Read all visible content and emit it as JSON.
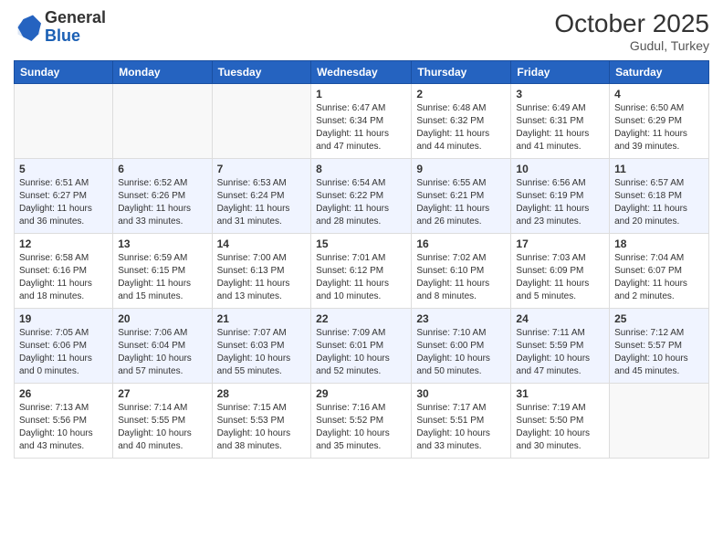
{
  "header": {
    "logo_general": "General",
    "logo_blue": "Blue",
    "month_title": "October 2025",
    "location": "Gudul, Turkey"
  },
  "weekdays": [
    "Sunday",
    "Monday",
    "Tuesday",
    "Wednesday",
    "Thursday",
    "Friday",
    "Saturday"
  ],
  "weeks": [
    [
      {
        "day": "",
        "info": ""
      },
      {
        "day": "",
        "info": ""
      },
      {
        "day": "",
        "info": ""
      },
      {
        "day": "1",
        "info": "Sunrise: 6:47 AM\nSunset: 6:34 PM\nDaylight: 11 hours\nand 47 minutes."
      },
      {
        "day": "2",
        "info": "Sunrise: 6:48 AM\nSunset: 6:32 PM\nDaylight: 11 hours\nand 44 minutes."
      },
      {
        "day": "3",
        "info": "Sunrise: 6:49 AM\nSunset: 6:31 PM\nDaylight: 11 hours\nand 41 minutes."
      },
      {
        "day": "4",
        "info": "Sunrise: 6:50 AM\nSunset: 6:29 PM\nDaylight: 11 hours\nand 39 minutes."
      }
    ],
    [
      {
        "day": "5",
        "info": "Sunrise: 6:51 AM\nSunset: 6:27 PM\nDaylight: 11 hours\nand 36 minutes."
      },
      {
        "day": "6",
        "info": "Sunrise: 6:52 AM\nSunset: 6:26 PM\nDaylight: 11 hours\nand 33 minutes."
      },
      {
        "day": "7",
        "info": "Sunrise: 6:53 AM\nSunset: 6:24 PM\nDaylight: 11 hours\nand 31 minutes."
      },
      {
        "day": "8",
        "info": "Sunrise: 6:54 AM\nSunset: 6:22 PM\nDaylight: 11 hours\nand 28 minutes."
      },
      {
        "day": "9",
        "info": "Sunrise: 6:55 AM\nSunset: 6:21 PM\nDaylight: 11 hours\nand 26 minutes."
      },
      {
        "day": "10",
        "info": "Sunrise: 6:56 AM\nSunset: 6:19 PM\nDaylight: 11 hours\nand 23 minutes."
      },
      {
        "day": "11",
        "info": "Sunrise: 6:57 AM\nSunset: 6:18 PM\nDaylight: 11 hours\nand 20 minutes."
      }
    ],
    [
      {
        "day": "12",
        "info": "Sunrise: 6:58 AM\nSunset: 6:16 PM\nDaylight: 11 hours\nand 18 minutes."
      },
      {
        "day": "13",
        "info": "Sunrise: 6:59 AM\nSunset: 6:15 PM\nDaylight: 11 hours\nand 15 minutes."
      },
      {
        "day": "14",
        "info": "Sunrise: 7:00 AM\nSunset: 6:13 PM\nDaylight: 11 hours\nand 13 minutes."
      },
      {
        "day": "15",
        "info": "Sunrise: 7:01 AM\nSunset: 6:12 PM\nDaylight: 11 hours\nand 10 minutes."
      },
      {
        "day": "16",
        "info": "Sunrise: 7:02 AM\nSunset: 6:10 PM\nDaylight: 11 hours\nand 8 minutes."
      },
      {
        "day": "17",
        "info": "Sunrise: 7:03 AM\nSunset: 6:09 PM\nDaylight: 11 hours\nand 5 minutes."
      },
      {
        "day": "18",
        "info": "Sunrise: 7:04 AM\nSunset: 6:07 PM\nDaylight: 11 hours\nand 2 minutes."
      }
    ],
    [
      {
        "day": "19",
        "info": "Sunrise: 7:05 AM\nSunset: 6:06 PM\nDaylight: 11 hours\nand 0 minutes."
      },
      {
        "day": "20",
        "info": "Sunrise: 7:06 AM\nSunset: 6:04 PM\nDaylight: 10 hours\nand 57 minutes."
      },
      {
        "day": "21",
        "info": "Sunrise: 7:07 AM\nSunset: 6:03 PM\nDaylight: 10 hours\nand 55 minutes."
      },
      {
        "day": "22",
        "info": "Sunrise: 7:09 AM\nSunset: 6:01 PM\nDaylight: 10 hours\nand 52 minutes."
      },
      {
        "day": "23",
        "info": "Sunrise: 7:10 AM\nSunset: 6:00 PM\nDaylight: 10 hours\nand 50 minutes."
      },
      {
        "day": "24",
        "info": "Sunrise: 7:11 AM\nSunset: 5:59 PM\nDaylight: 10 hours\nand 47 minutes."
      },
      {
        "day": "25",
        "info": "Sunrise: 7:12 AM\nSunset: 5:57 PM\nDaylight: 10 hours\nand 45 minutes."
      }
    ],
    [
      {
        "day": "26",
        "info": "Sunrise: 7:13 AM\nSunset: 5:56 PM\nDaylight: 10 hours\nand 43 minutes."
      },
      {
        "day": "27",
        "info": "Sunrise: 7:14 AM\nSunset: 5:55 PM\nDaylight: 10 hours\nand 40 minutes."
      },
      {
        "day": "28",
        "info": "Sunrise: 7:15 AM\nSunset: 5:53 PM\nDaylight: 10 hours\nand 38 minutes."
      },
      {
        "day": "29",
        "info": "Sunrise: 7:16 AM\nSunset: 5:52 PM\nDaylight: 10 hours\nand 35 minutes."
      },
      {
        "day": "30",
        "info": "Sunrise: 7:17 AM\nSunset: 5:51 PM\nDaylight: 10 hours\nand 33 minutes."
      },
      {
        "day": "31",
        "info": "Sunrise: 7:19 AM\nSunset: 5:50 PM\nDaylight: 10 hours\nand 30 minutes."
      },
      {
        "day": "",
        "info": ""
      }
    ]
  ]
}
